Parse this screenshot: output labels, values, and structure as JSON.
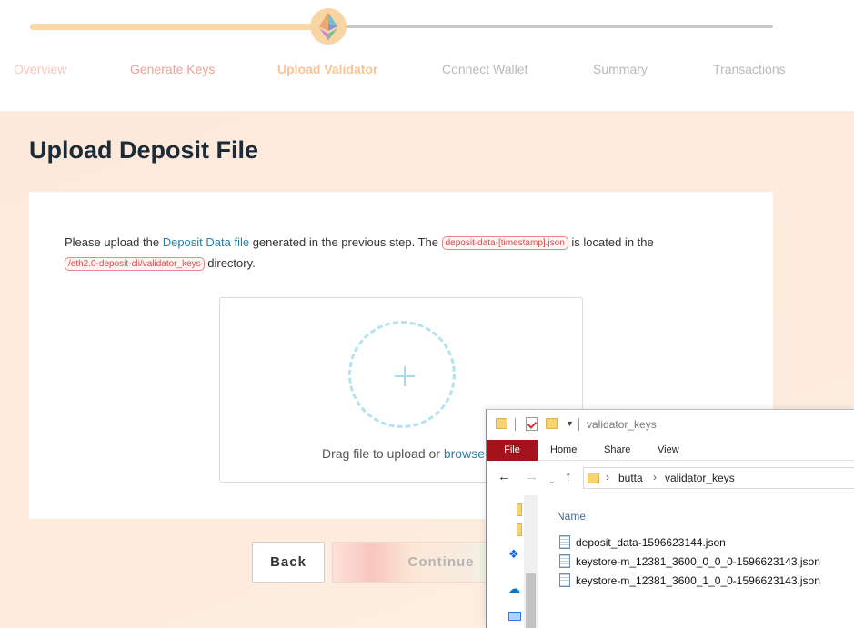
{
  "progress": {
    "steps": [
      "Overview",
      "Generate Keys",
      "Upload Validator",
      "Connect Wallet",
      "Summary",
      "Transactions"
    ],
    "active_step": "Upload Validator",
    "badge_icon": "ethereum-icon"
  },
  "main": {
    "title": "Upload Deposit File",
    "intro": {
      "part1": "Please upload the ",
      "link": "Deposit Data file",
      "part2": " generated in the previous step. The ",
      "code1": "deposit-data-[timestamp].json",
      "part3": " is located in the ",
      "code2": "/eth2.0-deposit-cli/validator_keys",
      "part4": " directory."
    },
    "dropzone": {
      "text": "Drag file to upload or ",
      "link": "browse",
      "icon": "plus-icon"
    },
    "buttons": {
      "back": "Back",
      "continue": "Continue"
    }
  },
  "explorer": {
    "title": "validator_keys",
    "ribbon_tabs": [
      "File",
      "Home",
      "Share",
      "View"
    ],
    "address": [
      "butta",
      "validator_keys"
    ],
    "column_header": "Name",
    "files": [
      "deposit_data-1596623144.json",
      "keystore-m_12381_3600_0_0_0-1596623143.json",
      "keystore-m_12381_3600_1_0_0-1596623143.json"
    ],
    "colors": {
      "file_tab": "#a4131b"
    }
  },
  "colors": {
    "accent_link": "#2b80a5",
    "code_red": "#d84a4a",
    "progress_done": "#fbd7a7",
    "title": "#1c2b38"
  }
}
